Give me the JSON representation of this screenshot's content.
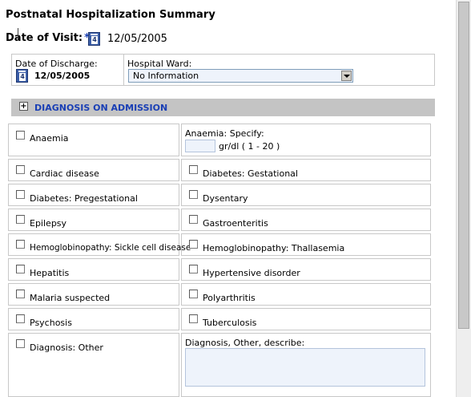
{
  "page": {
    "title": "Postnatal Hospitalization Summary",
    "visit_label": "Date of Visit:",
    "required_marker": "*",
    "visit_date": "12/05/2005"
  },
  "discharge": {
    "label": "Date of Discharge:",
    "date": "12/05/2005"
  },
  "ward": {
    "label": "Hospital Ward:",
    "selected": "No Information"
  },
  "section": {
    "expand_symbol": "+",
    "title": "DIAGNOSIS ON ADMISSION"
  },
  "diagnoses": {
    "anaemia": "Anaemia",
    "anaemia_specify": "Anaemia: Specify:",
    "anaemia_unit": "gr/dl ( 1 - 20 )",
    "cardiac": "Cardiac disease",
    "diabetes_gest": "Diabetes: Gestational",
    "diabetes_preg": "Diabetes: Pregestational",
    "dysentary": "Dysentary",
    "epilepsy": "Epilepsy",
    "gastro": "Gastroenteritis",
    "hemo_sickle": "Hemoglobinopathy: Sickle cell disease",
    "hemo_thal": "Hemoglobinopathy: Thallasemia",
    "hepatitis": "Hepatitis",
    "hypertensive": "Hypertensive disorder",
    "malaria": "Malaria suspected",
    "polyarthritis": "Polyarthritis",
    "psychosis": "Psychosis",
    "tuberculosis": "Tuberculosis",
    "other": "Diagnosis: Other",
    "other_describe": "Diagnosis, Other, describe:"
  },
  "colors": {
    "accent": "#1a3fb5",
    "section_bg": "#c4c4c4",
    "input_bg": "#eef3fb"
  }
}
